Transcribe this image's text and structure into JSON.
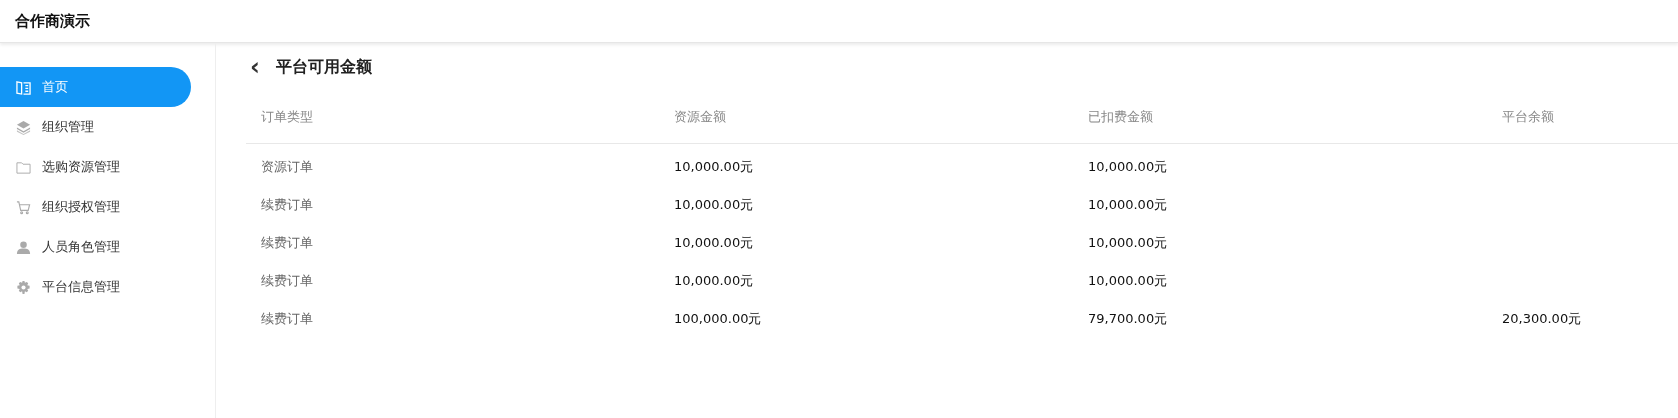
{
  "header": {
    "title": "合作商演示"
  },
  "sidebar": {
    "items": [
      {
        "label": "首页",
        "selected": true
      },
      {
        "label": "组织管理",
        "selected": false
      },
      {
        "label": "选购资源管理",
        "selected": false
      },
      {
        "label": "组织授权管理",
        "selected": false
      },
      {
        "label": "人员角色管理",
        "selected": false
      },
      {
        "label": "平台信息管理",
        "selected": false
      }
    ]
  },
  "page": {
    "back_icon": "‹",
    "title": "平台可用金额"
  },
  "table": {
    "columns": [
      "订单类型",
      "资源金额",
      "已扣费金额",
      "平台余额"
    ],
    "rows": [
      [
        "资源订单",
        "10,000.00元",
        "10,000.00元"
      ],
      [
        "续费订单",
        "10,000.00元",
        "10,000.00元"
      ],
      [
        "续费订单",
        "10,000.00元",
        "10,000.00元"
      ],
      [
        "续费订单",
        "10,000.00元",
        "10,000.00元"
      ],
      [
        "续费订单",
        "100,000.00元",
        "79,700.00元",
        "20,300.00元"
      ]
    ]
  }
}
